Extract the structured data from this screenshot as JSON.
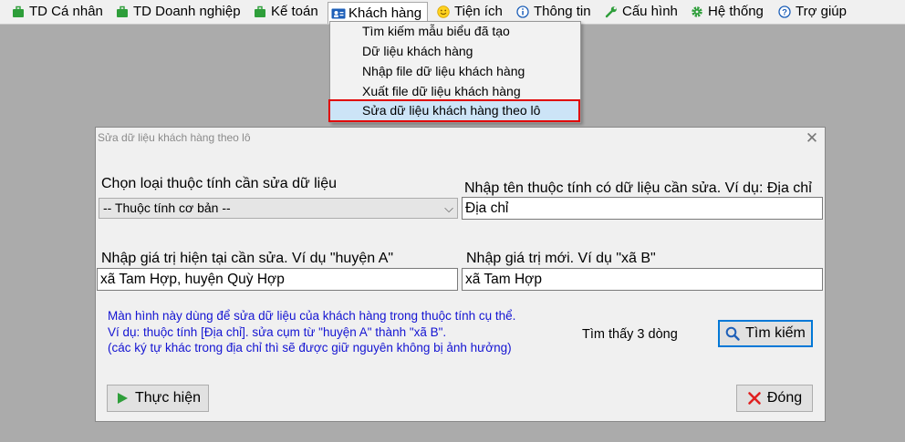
{
  "menubar": {
    "items": [
      {
        "label": "TD Cá nhân",
        "icon": "briefcase-icon"
      },
      {
        "label": "TD Doanh nghiệp",
        "icon": "briefcase-icon"
      },
      {
        "label": "Kế toán",
        "icon": "briefcase-icon"
      },
      {
        "label": "Khách hàng",
        "icon": "contact-card-icon"
      },
      {
        "label": "Tiện ích",
        "icon": "smiley-icon"
      },
      {
        "label": "Thông tin",
        "icon": "info-icon"
      },
      {
        "label": "Cấu hình",
        "icon": "wrench-icon"
      },
      {
        "label": "Hệ thống",
        "icon": "gear-icon"
      },
      {
        "label": "Trợ giúp",
        "icon": "help-icon"
      }
    ]
  },
  "dropdown": {
    "items": [
      "Tìm kiếm mẫu biểu đã tạo",
      "Dữ liệu khách hàng",
      "Nhập file dữ liệu khách hàng",
      "Xuất file dữ liệu khách hàng",
      "Sửa dữ liệu khách hàng theo lô"
    ]
  },
  "dialog": {
    "title": "Sửa dữ liệu khách hàng theo lô",
    "attribute_type_label": "Chọn loại thuộc tính cần sửa dữ liệu",
    "attribute_type_value": "-- Thuộc tính cơ bản --",
    "attribute_name_label": "Nhập tên thuộc tính có dữ liệu cần sửa. Ví dụ: Địa chỉ",
    "attribute_name_value": "Địa chỉ",
    "current_value_label": "Nhập giá trị hiện tại cần sửa. Ví dụ \"huyện A\"",
    "current_value": "xã Tam Hợp, huyện Quỳ Hợp",
    "new_value_label": "Nhập giá trị mới. Ví dụ \"xã B\"",
    "new_value": "xã Tam Hợp",
    "info_lines": [
      "Màn hình này dùng để sửa dữ liệu của khách hàng trong thuộc tính cụ thể.",
      "Ví dụ: thuộc tính [Địa chỉ]. sửa cụm từ \"huyện A\" thành \"xã B\".",
      "(các ký tự khác trong địa chỉ thì sẽ được giữ nguyên không bị ảnh hưởng)"
    ],
    "found_text": "Tìm thấy 3 dòng",
    "search_button": "Tìm kiếm",
    "execute_button": "Thực hiện",
    "close_button": "Đóng"
  },
  "colors": {
    "highlight": "#cce4f7",
    "highlight_border": "#e00000",
    "info_text": "#1414d2",
    "accent": "#0078d7"
  }
}
